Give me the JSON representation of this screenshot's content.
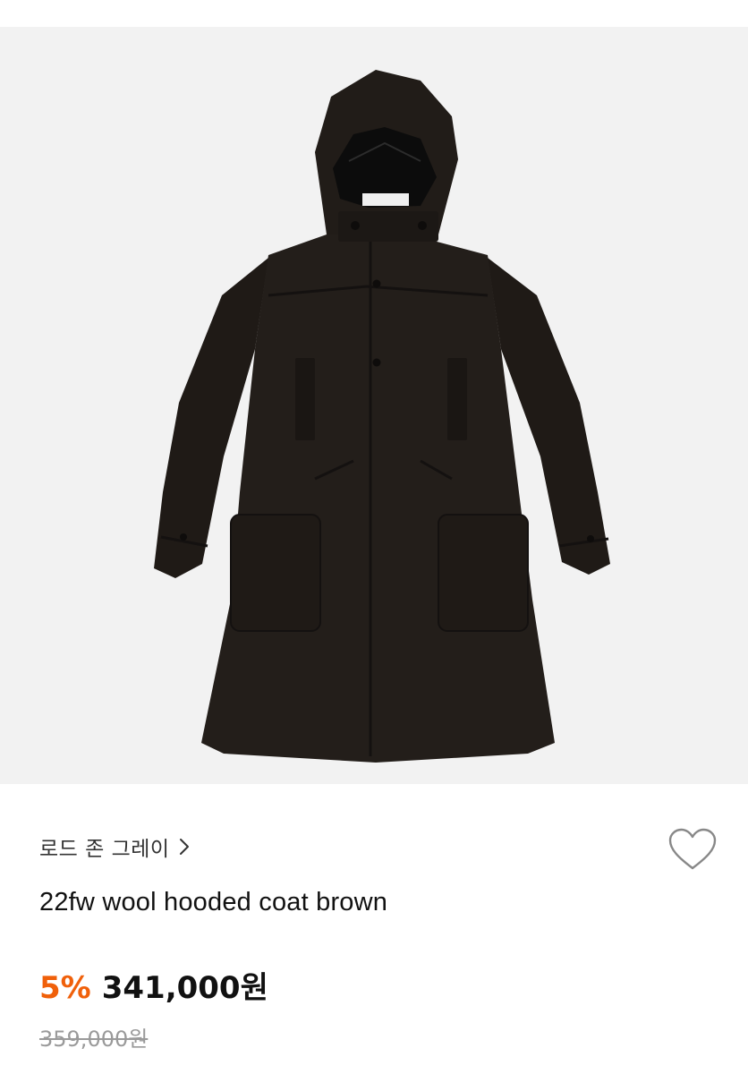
{
  "product": {
    "image_icon": "wool-hooded-coat-photo",
    "brand": "로드 존 그레이",
    "title": "22fw wool hooded coat brown",
    "discount_rate": "5%",
    "sale_price": "341,000원",
    "original_price": "359,000원",
    "wishlist_icon": "heart-outline-icon"
  },
  "colors": {
    "accent_discount": "#f0600a",
    "image_background": "#f2f2f2",
    "coat": "#221d19"
  }
}
